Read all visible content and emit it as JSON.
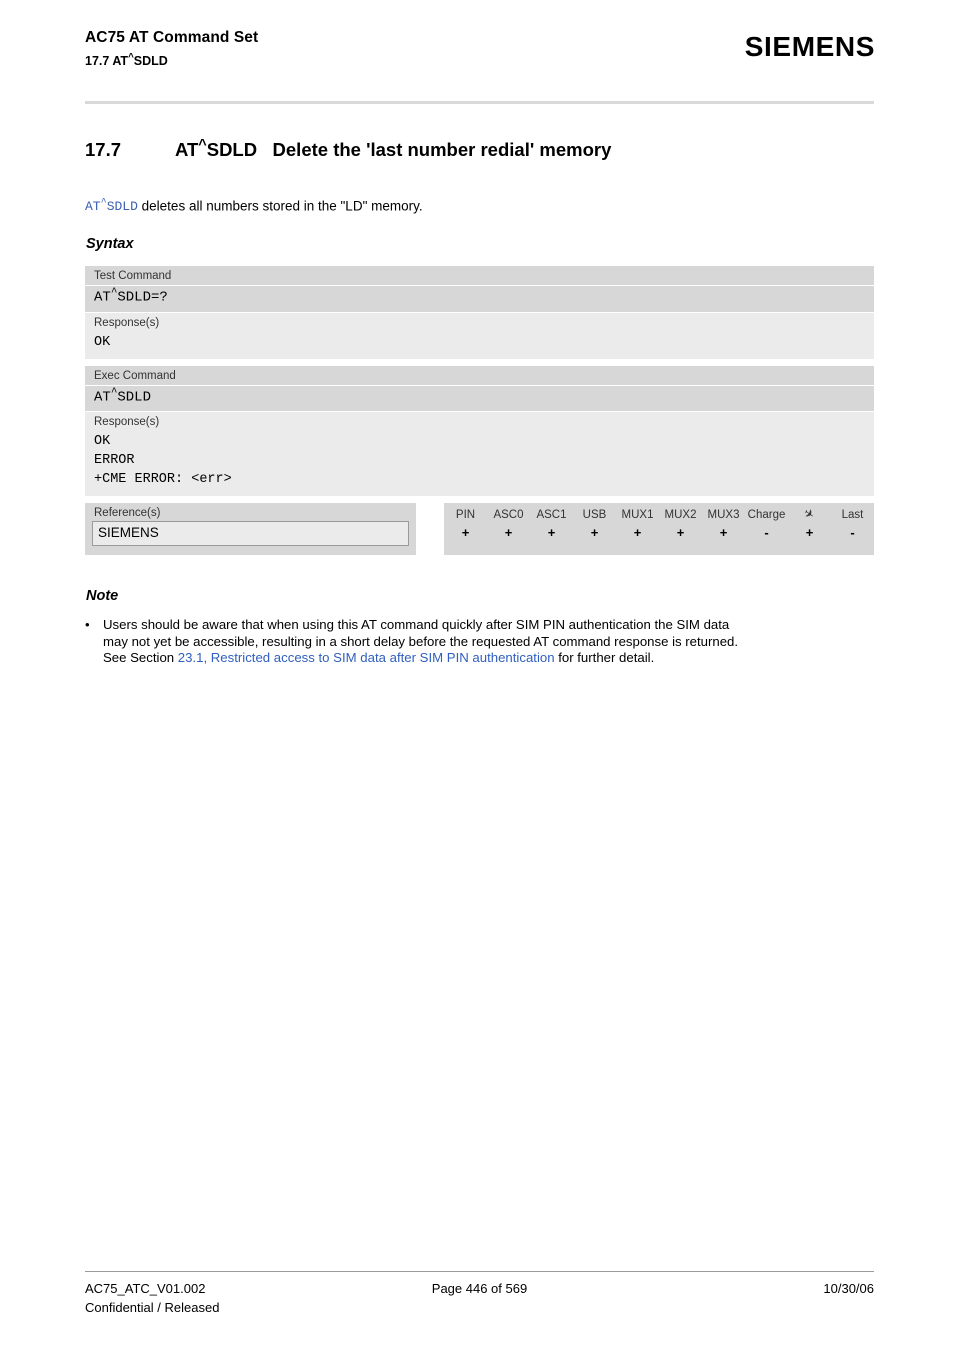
{
  "header": {
    "title": "AC75 AT Command Set",
    "subtitle": "17.7 AT^SDLD",
    "logo": "SIEMENS"
  },
  "section": {
    "number": "17.7",
    "command": "AT^SDLD",
    "title": "Delete the 'last number redial' memory",
    "intro_command": "AT^SDLD",
    "intro_text": " deletes all numbers stored in the \"LD\" memory."
  },
  "labels": {
    "syntax": "Syntax",
    "note": "Note"
  },
  "syntax": {
    "blocks": [
      {
        "head_label": "Test Command",
        "command": "AT^SDLD=?",
        "resp_label": "Response(s)",
        "responses": [
          "OK"
        ]
      },
      {
        "head_label": "Exec Command",
        "command": "AT^SDLD",
        "resp_label": "Response(s)",
        "responses": [
          "OK",
          "ERROR",
          "+CME ERROR: <err>"
        ]
      }
    ]
  },
  "reference": {
    "label": "Reference(s)",
    "value": "SIEMENS"
  },
  "support": {
    "columns": [
      "PIN",
      "ASC0",
      "ASC1",
      "USB",
      "MUX1",
      "MUX2",
      "MUX3",
      "Charge",
      "airplane-icon",
      "Last"
    ],
    "values": [
      "+",
      "+",
      "+",
      "+",
      "+",
      "+",
      "+",
      "-",
      "+",
      "-"
    ]
  },
  "note": {
    "bullet": "•",
    "line1": "Users should be aware that when using this AT command quickly after SIM PIN authentication the SIM data",
    "line2": "may not yet be accessible, resulting in a short delay before the requested AT command response is returned.",
    "line3_pre": "See Section ",
    "line3_link": "23.1, Restricted access to SIM data after SIM PIN authentication",
    "line3_post": " for further detail."
  },
  "footer": {
    "doc_id": "AC75_ATC_V01.002",
    "page": "Page 446 of 569",
    "date": "10/30/06",
    "status": "Confidential / Released"
  },
  "colors": {
    "link": "#2f5fbf",
    "command_blue": "#3b5fb0",
    "header_gray": "#d7d7d7",
    "panel_gray": "#ebebeb",
    "rule_gray": "#d9d9d9"
  }
}
